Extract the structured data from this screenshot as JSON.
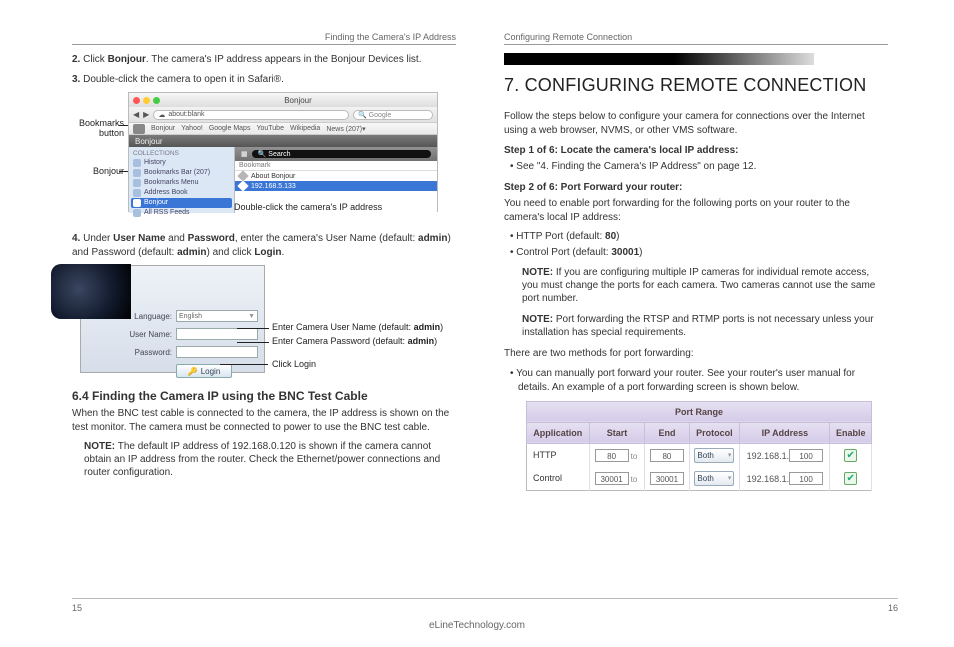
{
  "left": {
    "header": "Finding the Camera's IP Address",
    "step2_num": "2.",
    "step2_a": "Click ",
    "step2_b": "Bonjour",
    "step2_c": ". The camera's IP address appears in the Bonjour Devices list.",
    "step3_num": "3.",
    "step3": "Double-click the camera to open it in Safari®.",
    "labels": {
      "bookmarks": "Bookmarks button",
      "bonjour": "Bonjour",
      "dblclick": "Double-click the camera's IP address"
    },
    "safari": {
      "title": "Bonjour",
      "addr_icon": "☁",
      "addr": "about:blank",
      "search": "Google",
      "bookmarks": [
        "Bonjour",
        "Yahoo!",
        "Google Maps",
        "YouTube",
        "Wikipedia",
        "News (207)▾"
      ],
      "bar_label": "Bonjour",
      "side_header": "COLLECTIONS",
      "side_items": [
        "History",
        "Bookmarks Bar (207)",
        "Bookmarks Menu",
        "Address Book",
        "Bonjour",
        "All RSS Feeds"
      ],
      "side_selected_index": 4,
      "main_search_ph": "Search",
      "main_col": "Bookmark",
      "main_items": [
        "About Bonjour",
        "192.168.5.133"
      ],
      "main_selected_index": 1
    },
    "step4_num": "4.",
    "step4_a": "Under ",
    "step4_b": "User Name",
    "step4_c": " and ",
    "step4_d": "Password",
    "step4_e": ", enter the camera's User Name (default: ",
    "step4_f": "admin",
    "step4_g": ") and Password (default: ",
    "step4_h": "admin",
    "step4_i": ") and click ",
    "step4_j": "Login",
    "step4_k": ".",
    "login": {
      "lang_label": "Language:",
      "lang_value": "English",
      "user_label": "User Name:",
      "pass_label": "Password:",
      "button": "Login",
      "hint_user_a": "Enter Camera User Name (default: ",
      "hint_user_b": "admin",
      "hint_user_c": ")",
      "hint_pass_a": "Enter Camera Password (default: ",
      "hint_pass_b": "admin",
      "hint_pass_c": ")",
      "hint_btn": "Click Login"
    },
    "h64": "6.4  Finding the Camera IP using the BNC Test Cable",
    "p64": "When the BNC test cable is connected to the camera, the IP address is shown on the test monitor. The camera must be connected to power to use the BNC test cable.",
    "note64_a": "NOTE:",
    "note64_b": " The default IP address of 192.168.0.120 is shown if the camera cannot obtain an IP address from the router. Check the Ethernet/power connections and router configuration.",
    "page_num": "15"
  },
  "right": {
    "header": "Configuring Remote Connection",
    "title": "7. CONFIGURING REMOTE CONNECTION",
    "intro": "Follow the steps below to configure your camera for connections over the Internet using a web browser, NVMS, or other VMS software.",
    "s1_head": "Step 1 of 6: Locate the camera's local IP address:",
    "s1_bul": "See \"4. Finding the Camera's IP Address\" on page 12.",
    "s2_head": "Step 2 of 6: Port Forward your router:",
    "s2_para": "You need to enable port forwarding for the following ports on your router to the camera's local IP address:",
    "s2_b1_a": "HTTP Port (default: ",
    "s2_b1_b": "80",
    "s2_b1_c": ")",
    "s2_b2_a": "Control Port (default: ",
    "s2_b2_b": "30001",
    "s2_b2_c": ")",
    "note1_a": "NOTE:",
    "note1_b": " If you are configuring multiple IP cameras for individual remote access, you must change the ports for each camera. Two cameras cannot use the same port number.",
    "note2_a": "NOTE:",
    "note2_b": " Port forwarding the RTSP and RTMP ports is not necessary unless your installation has special requirements.",
    "methods": "There are two methods for port forwarding:",
    "m1": "You can manually port forward your router. See your router's user manual for details. An example of a port forwarding screen is shown below.",
    "pf": {
      "head_title": "Port Range",
      "cols": [
        "Application",
        "Start",
        "End",
        "Protocol",
        "IP Address",
        "Enable"
      ],
      "rows": [
        {
          "app": "HTTP",
          "start": "80",
          "end": "80",
          "proto": "Both",
          "ip_prefix": "192.168.1.",
          "ip_last": "100",
          "enabled": true
        },
        {
          "app": "Control",
          "start": "30001",
          "end": "30001",
          "proto": "Both",
          "ip_prefix": "192.168.1.",
          "ip_last": "100",
          "enabled": true
        }
      ]
    },
    "page_num": "16"
  },
  "footer_site": "eLineTechnology.com"
}
